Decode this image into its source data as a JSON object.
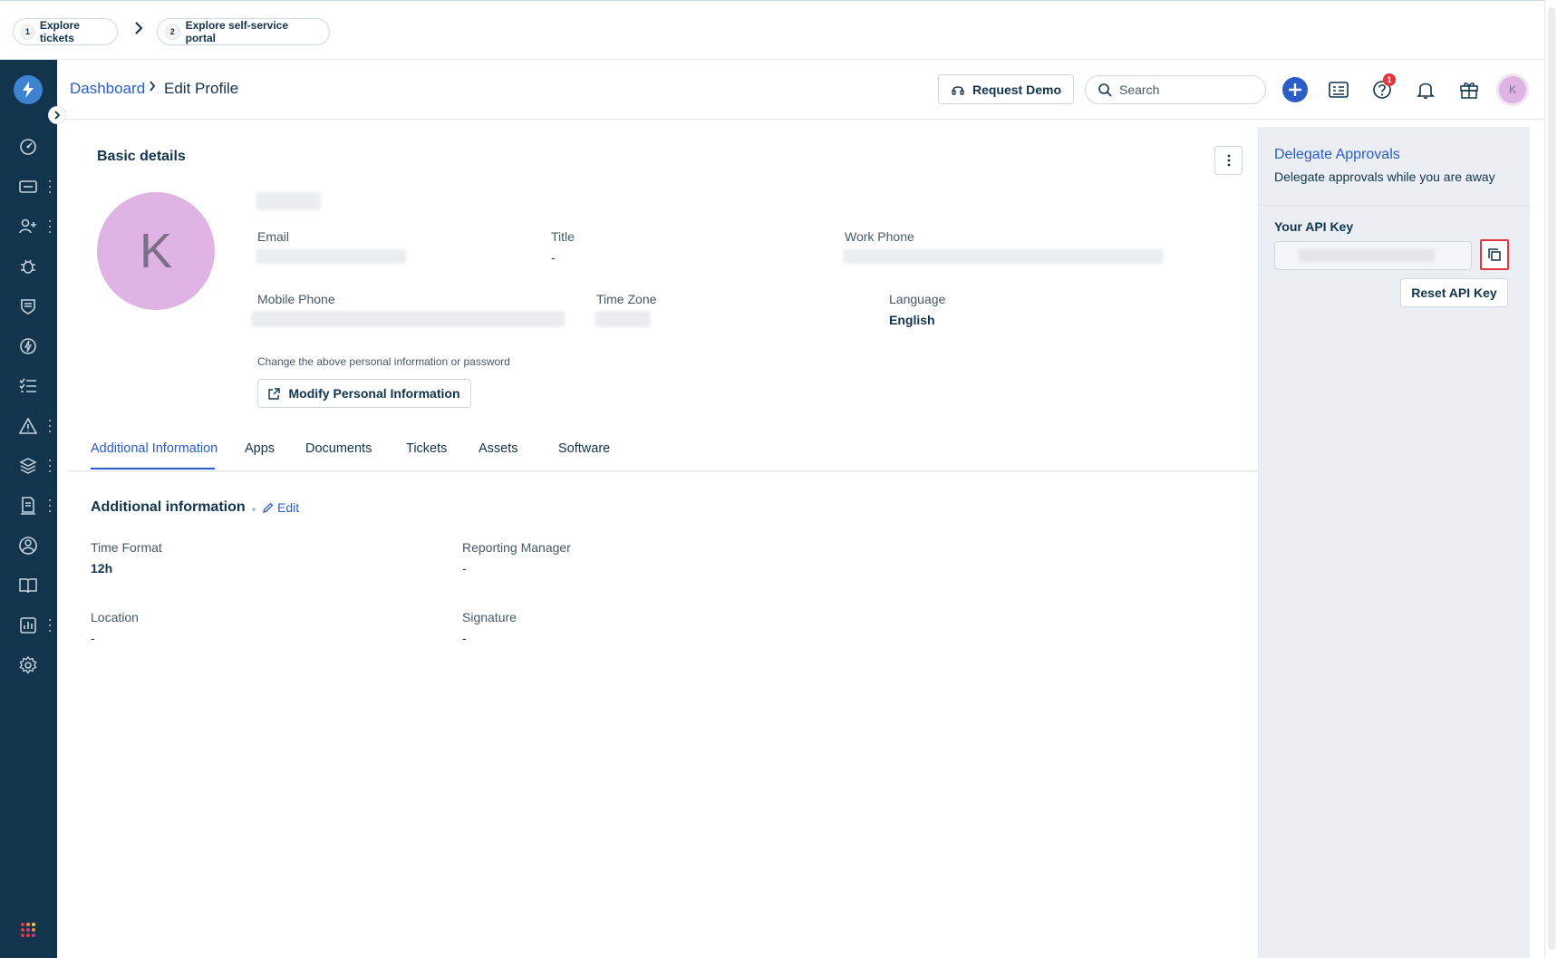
{
  "onboarding": {
    "steps": [
      {
        "num": "1",
        "label": "Explore tickets"
      },
      {
        "num": "2",
        "label": "Explore self-service portal"
      }
    ]
  },
  "breadcrumb": {
    "parent": "Dashboard",
    "current": "Edit Profile"
  },
  "header": {
    "request_demo": "Request Demo",
    "search_placeholder": "Search",
    "help_badge": "1",
    "avatar_initial": "K"
  },
  "profile": {
    "section_title": "Basic details",
    "avatar_initial": "K",
    "fields": {
      "email_label": "Email",
      "title_label": "Title",
      "title_value": "-",
      "work_phone_label": "Work Phone",
      "mobile_phone_label": "Mobile Phone",
      "time_zone_label": "Time Zone",
      "language_label": "Language",
      "language_value": "English"
    },
    "hint": "Change the above personal information or password",
    "modify_button": "Modify Personal Information"
  },
  "tabs": [
    {
      "label": "Additional Information",
      "active": true
    },
    {
      "label": "Apps"
    },
    {
      "label": "Documents"
    },
    {
      "label": "Tickets"
    },
    {
      "label": "Assets"
    },
    {
      "label": "Software"
    }
  ],
  "additional": {
    "title": "Additional information",
    "edit_label": "Edit",
    "fields": [
      {
        "label": "Time Format",
        "value": "12h"
      },
      {
        "label": "Reporting Manager",
        "value": "-"
      },
      {
        "label": "Location",
        "value": "-"
      },
      {
        "label": "Signature",
        "value": "-"
      }
    ]
  },
  "right_panel": {
    "delegate_title": "Delegate Approvals",
    "delegate_sub": "Delegate approvals while you are away",
    "api_key_label": "Your API Key",
    "reset_button": "Reset API Key"
  },
  "colors": {
    "sidebar": "#12344d",
    "accent": "#2c5cc5",
    "avatar": "#dfb3e3",
    "highlight": "#e2373f"
  }
}
